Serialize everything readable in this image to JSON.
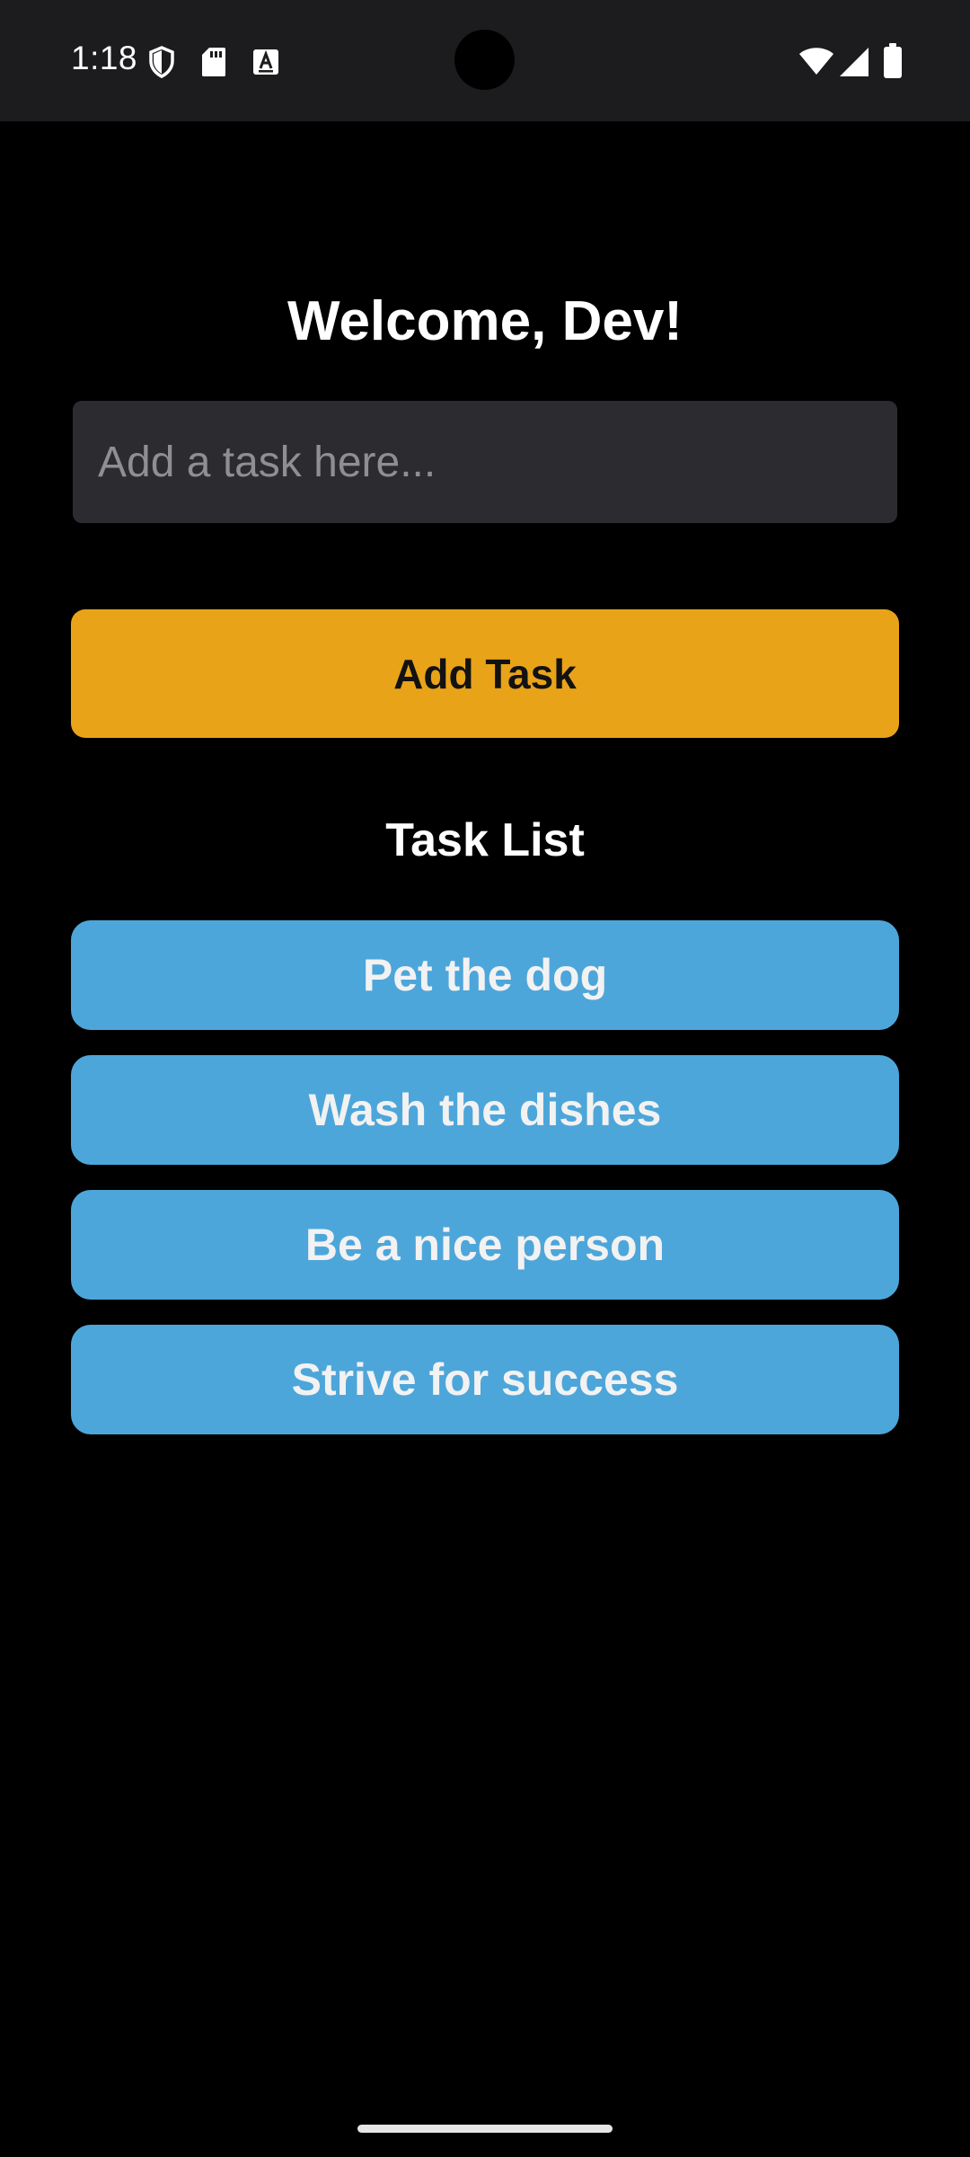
{
  "status_bar": {
    "time": "1:18",
    "left_icons": [
      "shield-icon",
      "sd-card-icon",
      "keyboard-a-icon"
    ],
    "right_icons": [
      "wifi-icon",
      "signal-icon",
      "battery-icon"
    ]
  },
  "header": {
    "welcome": "Welcome, Dev!"
  },
  "task_input": {
    "placeholder": "Add a task here...",
    "value": ""
  },
  "add_button": {
    "label": "Add Task"
  },
  "task_list": {
    "title": "Task List",
    "items": [
      "Pet the dog",
      "Wash the dishes",
      "Be a nice person",
      "Strive for success"
    ]
  },
  "colors": {
    "background": "#000000",
    "status_bar": "#1c1c1e",
    "input_background": "#2c2c30",
    "accent_button": "#e9a318",
    "task_item": "#4da6da"
  }
}
